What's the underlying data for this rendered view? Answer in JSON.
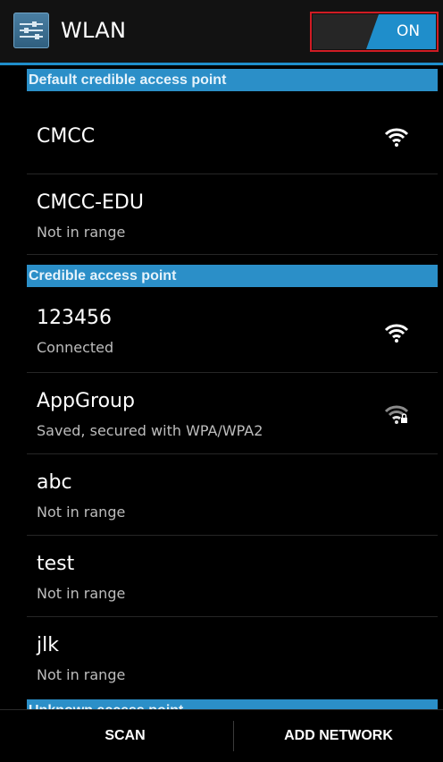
{
  "header": {
    "title": "WLAN",
    "toggle_label": "ON",
    "toggle_state": "on"
  },
  "colors": {
    "accent": "#1f8ecb",
    "section_header": "#2b8fc8",
    "highlight_border": "#d01c24",
    "background": "#000000",
    "secondary_text": "#bdbdbd"
  },
  "sections": [
    {
      "title": "Default credible access point",
      "networks": [
        {
          "name": "CMCC",
          "status": "",
          "signal_icon": "wifi-full-icon"
        },
        {
          "name": "CMCC-EDU",
          "status": "Not in range",
          "signal_icon": ""
        }
      ]
    },
    {
      "title": "Credible access point",
      "networks": [
        {
          "name": "123456",
          "status": "Connected",
          "signal_icon": "wifi-full-icon"
        },
        {
          "name": "AppGroup",
          "status": "Saved, secured with WPA/WPA2",
          "signal_icon": "wifi-locked-icon"
        },
        {
          "name": "abc",
          "status": "Not in range",
          "signal_icon": ""
        },
        {
          "name": "test",
          "status": "Not in range",
          "signal_icon": ""
        },
        {
          "name": "jlk",
          "status": "Not in range",
          "signal_icon": ""
        }
      ]
    },
    {
      "title": "Unknown access point",
      "networks": []
    }
  ],
  "bottom_bar": {
    "scan_label": "SCAN",
    "add_network_label": "ADD NETWORK"
  }
}
